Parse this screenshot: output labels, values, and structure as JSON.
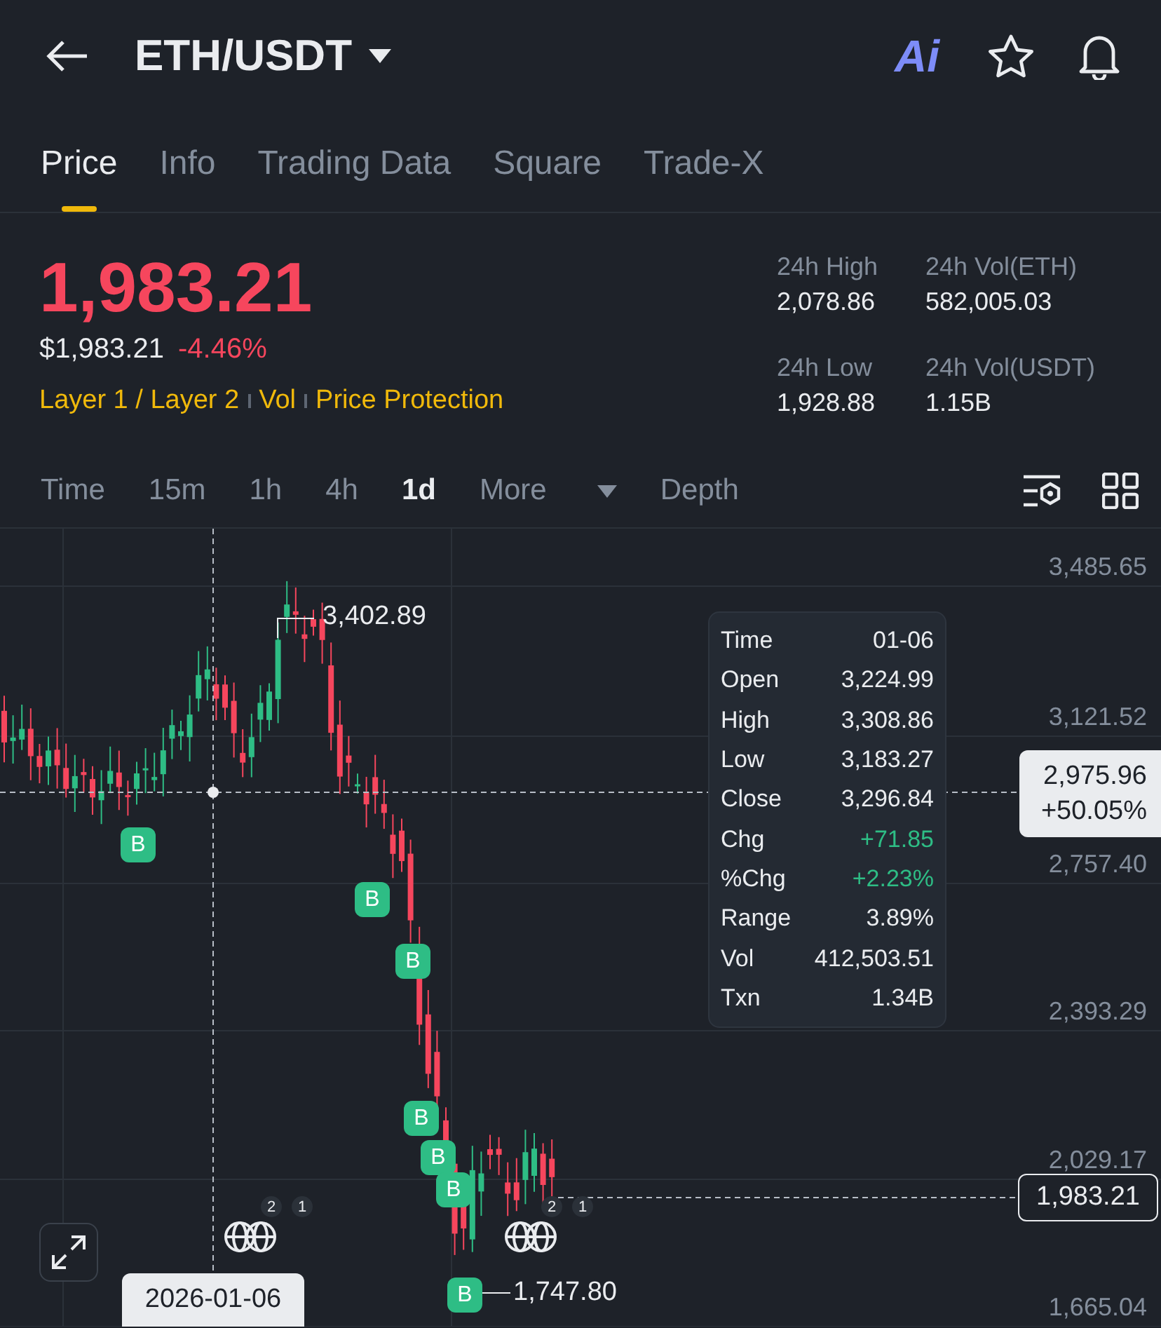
{
  "header": {
    "title": "ETH/USDT",
    "ai_label": "Ai"
  },
  "tabs": [
    {
      "label": "Price",
      "selected": true
    },
    {
      "label": "Info",
      "selected": false
    },
    {
      "label": "Trading Data",
      "selected": false
    },
    {
      "label": "Square",
      "selected": false
    },
    {
      "label": "Trade-X",
      "selected": false
    }
  ],
  "price": {
    "last": "1,983.21",
    "usd": "$1,983.21",
    "change": "-4.46%",
    "falling": true,
    "tags": [
      "Layer 1 / Layer 2",
      "Vol",
      "Price Protection"
    ]
  },
  "stats": [
    {
      "label": "24h High",
      "value": "2,078.86"
    },
    {
      "label": "24h Vol(ETH)",
      "value": "582,005.03"
    },
    {
      "label": "24h Low",
      "value": "1,928.88"
    },
    {
      "label": "24h Vol(USDT)",
      "value": "1.15B"
    }
  ],
  "intervals": [
    {
      "label": "Time",
      "kind": "plain",
      "selected": false
    },
    {
      "label": "15m",
      "kind": "plain",
      "selected": false
    },
    {
      "label": "1h",
      "kind": "plain",
      "selected": false
    },
    {
      "label": "4h",
      "kind": "plain",
      "selected": false
    },
    {
      "label": "1d",
      "kind": "plain",
      "selected": true
    },
    {
      "label": "More",
      "kind": "dropdown",
      "selected": false
    },
    {
      "label": "Depth",
      "kind": "plain",
      "selected": false
    }
  ],
  "chart": {
    "y_axis": [
      "3,485.65",
      "3,121.52",
      "2,757.40",
      "2,393.29",
      "2,029.17",
      "1,665.04"
    ],
    "high_label": "3,402.89",
    "low_label": "1,747.80",
    "last_price": "1,983.21",
    "crosshair_price": "2,975.96",
    "crosshair_change": "+50.05%",
    "crosshair_date": "2026-01-06",
    "markers": [
      "B",
      "B",
      "B",
      "B",
      "B",
      "B",
      "B"
    ],
    "event_groups": [
      {
        "counts": [
          "2",
          "1"
        ]
      },
      {
        "counts": [
          "2",
          "1"
        ]
      }
    ],
    "tooltip": [
      {
        "label": "Time",
        "value": "01-06",
        "positive": false
      },
      {
        "label": "Open",
        "value": "3,224.99",
        "positive": false
      },
      {
        "label": "High",
        "value": "3,308.86",
        "positive": false
      },
      {
        "label": "Low",
        "value": "3,183.27",
        "positive": false
      },
      {
        "label": "Close",
        "value": "3,296.84",
        "positive": false
      },
      {
        "label": "Chg",
        "value": "+71.85",
        "positive": true
      },
      {
        "label": "%Chg",
        "value": "+2.23%",
        "positive": true
      },
      {
        "label": "Range",
        "value": "3.89%",
        "positive": false
      },
      {
        "label": "Vol",
        "value": "412,503.51",
        "positive": false
      },
      {
        "label": "Txn",
        "value": "1.34B",
        "positive": false
      }
    ]
  }
}
